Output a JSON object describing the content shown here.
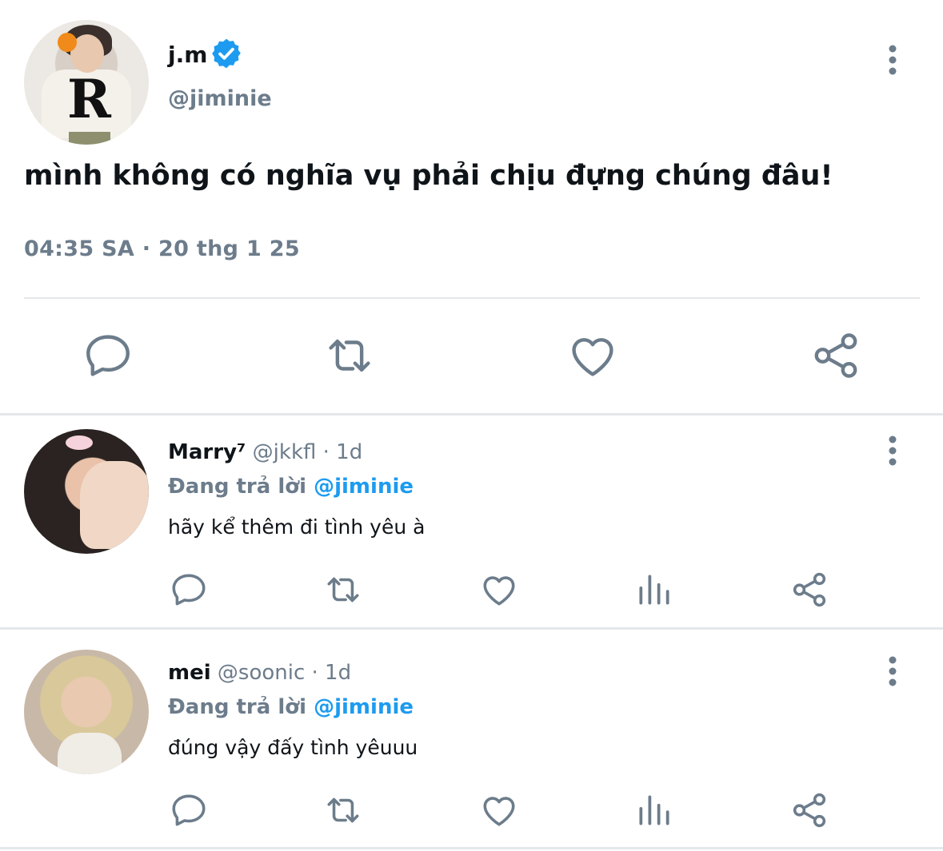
{
  "main_tweet": {
    "display_name": "j.m",
    "handle": "@jiminie",
    "text": "mình không có nghĩa vụ phải chịu đựng chúng đâu!",
    "timestamp": "04:35 SA · 20 thg 1 25",
    "actions": [
      "reply-icon",
      "retweet-icon",
      "like-icon",
      "share-icon"
    ]
  },
  "replies": [
    {
      "display_name": "Marry⁷",
      "handle": "@jkkfl",
      "age": "· 1d",
      "replying_label": "Đang trả lời",
      "replying_to": "@jiminie",
      "text": "hãy kể thêm đi tình yêu à"
    },
    {
      "display_name": "mei",
      "handle": "@soonic",
      "age": "· 1d",
      "replying_label": "Đang trả lời",
      "replying_to": "@jiminie",
      "text": "đúng vậy đấy tình yêuuu"
    }
  ],
  "colors": {
    "icon_gray": "#6c7c8b",
    "text": "#0f1419",
    "accent_blue": "#1d9bf0",
    "divider": "#e4e8eb"
  }
}
